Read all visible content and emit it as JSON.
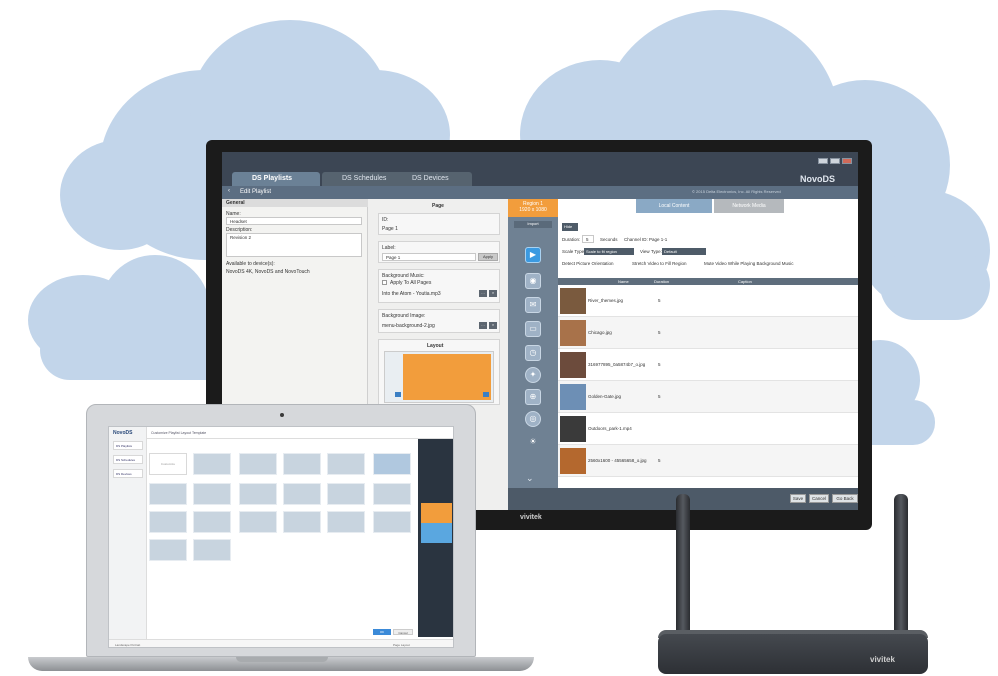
{
  "monitor": {
    "brand_logo": "vivitek"
  },
  "app": {
    "brand": "NovoDS",
    "tabs": [
      {
        "label": "DS Playlists"
      },
      {
        "label": "DS Schedules"
      },
      {
        "label": "DS Devices"
      }
    ],
    "breadcrumb": "Edit Playlist",
    "breadcrumb_right": "© 2015 Delta Electronics, Inc. All Rights Reserved"
  },
  "general": {
    "heading": "General",
    "name_label": "Name:",
    "name_value": "Headset",
    "description_label": "Description:",
    "description_value": "Revision 2",
    "available_label": "Available to device(s):",
    "available_value": "NovoDS 4K, NovoDS and NovoTouch"
  },
  "page": {
    "title": "Page",
    "id_label": "ID:",
    "id_value": "Page 1",
    "label_label": "Label:",
    "label_value": "Page 1",
    "apply_label": "Apply",
    "music_label": "Background Music:",
    "apply_all_label": "Apply To All Pages",
    "music_file": "Into the Atom - Youtia.mp3",
    "image_label": "Background Image:",
    "image_file": "menu-background-2.jpg",
    "layout_title": "Layout"
  },
  "region": {
    "name": "Region 1",
    "size": "1920 x 1080",
    "import_label": "Import"
  },
  "content": {
    "tab_active": "Local Content",
    "tab_inactive": "Network Media",
    "hide_label": "Hide",
    "duration_label": "Duration:",
    "duration_value": "5",
    "seconds_label": "Seconds",
    "channel_label": "Channel ID: Page 1-1",
    "scale_label": "Scale Type:",
    "scale_value": "Scale to fit region",
    "view_label": "View Type:",
    "view_value": "Default",
    "detect_label": "Detect Picture Orientation",
    "stretch_label": "Stretch Video to Fill Region",
    "mute_label": "Mute Video While Playing Background Music",
    "col_file": "Name",
    "col_duration": "Duration",
    "col_caption": "Caption",
    "rows": [
      {
        "name": "River_themes.jpg",
        "duration": "5"
      },
      {
        "name": "Chicago.jpg",
        "duration": "5"
      },
      {
        "name": "316977895_0a5874b7_o.jpg",
        "duration": "5"
      },
      {
        "name": "Golden-Gate.jpg",
        "duration": "5"
      },
      {
        "name": "Outdoors_park-1.mp4",
        "duration": ""
      },
      {
        "name": "2560x1600 - 45565658_o.jpg",
        "duration": "5"
      },
      {
        "name": "",
        "duration": ""
      }
    ]
  },
  "footer": {
    "save": "Save",
    "cancel": "Cancel",
    "go_back": "Go Back"
  },
  "laptop": {
    "brand": "NovoDS",
    "header": "Customize Playlist Layout Template",
    "sidebar": [
      "DS Playlists",
      "DS Schedules",
      "DS Devices"
    ],
    "blank_template": "Customize",
    "ok_label": "OK",
    "cancel_label": "Cancel",
    "footer_left": "Landscape   Portrait",
    "footer_right": "Page Layout"
  },
  "router": {
    "brand_logo": "vivitek"
  }
}
